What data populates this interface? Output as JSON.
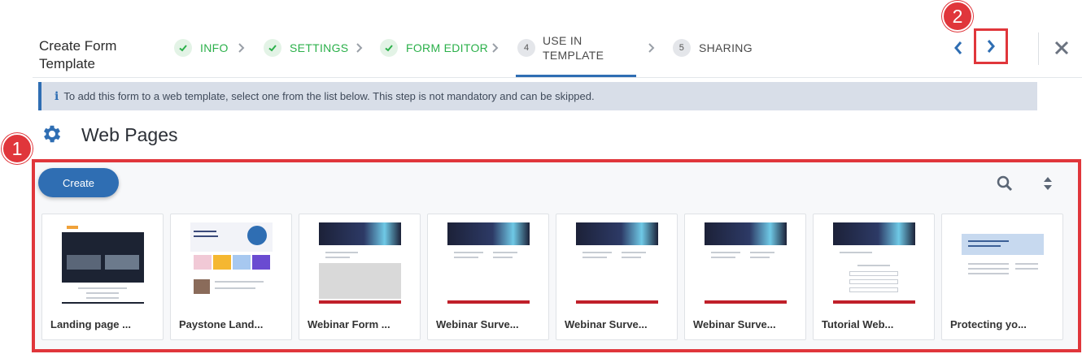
{
  "header": {
    "title": "Create Form Template",
    "steps": [
      {
        "label": "INFO",
        "state": "done"
      },
      {
        "label": "SETTINGS",
        "state": "done"
      },
      {
        "label": "FORM EDITOR",
        "state": "done"
      },
      {
        "num": "4",
        "label": "USE IN TEMPLATE",
        "state": "active"
      },
      {
        "num": "5",
        "label": "SHARING",
        "state": "todo"
      }
    ]
  },
  "callouts": {
    "one": "1",
    "two": "2"
  },
  "info": {
    "text": "To add this form to a web template, select one from the list below. This step is not mandatory and can be skipped.",
    "icon": "i"
  },
  "section": {
    "title": "Web Pages"
  },
  "toolbar": {
    "create_label": "Create"
  },
  "cards": [
    {
      "title": "Landing page ..."
    },
    {
      "title": "Paystone Land..."
    },
    {
      "title": "Webinar Form ..."
    },
    {
      "title": "Webinar Surve..."
    },
    {
      "title": "Webinar Surve..."
    },
    {
      "title": "Webinar Surve..."
    },
    {
      "title": "Tutorial Web..."
    },
    {
      "title": "Protecting yo..."
    }
  ],
  "colors": {
    "accent": "#2f6eb3",
    "success": "#2bb04a",
    "highlight": "#e0363b"
  }
}
